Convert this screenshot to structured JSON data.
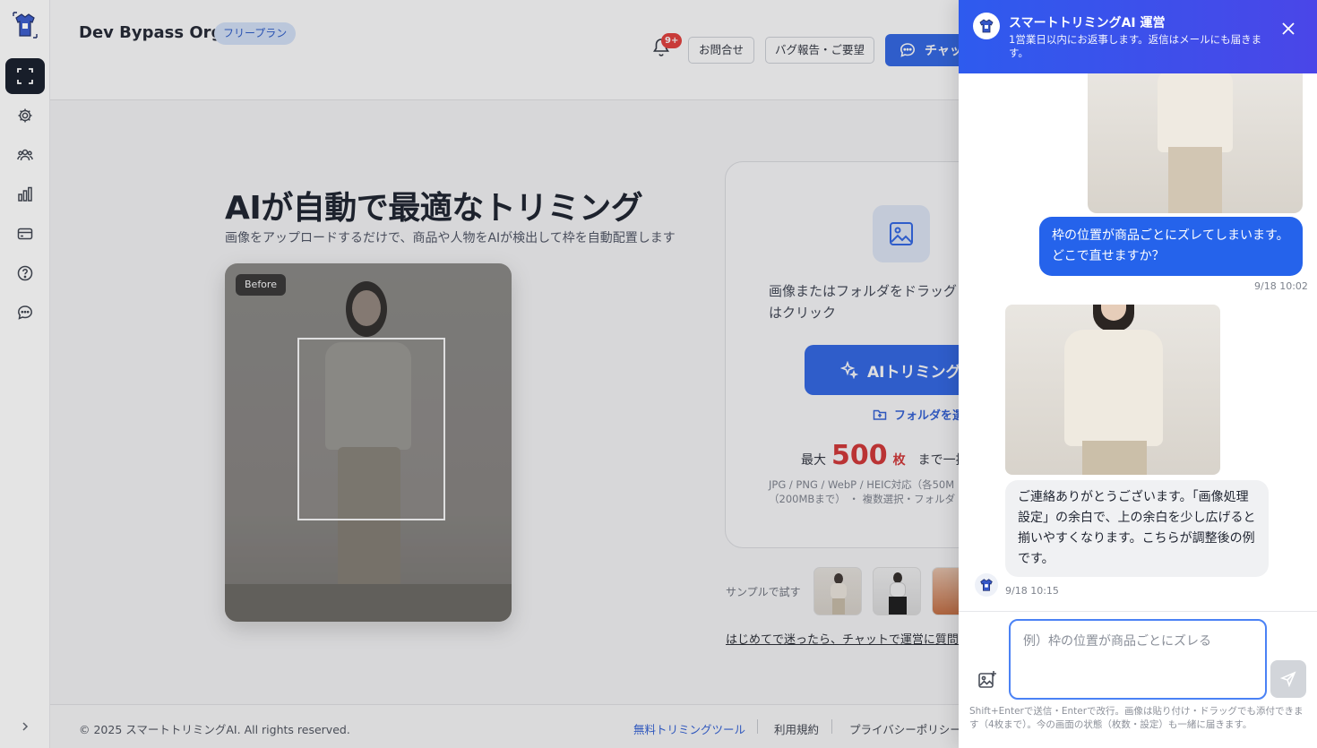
{
  "sidebar": {
    "items": [
      {
        "name": "trim",
        "icon": "expand-icon",
        "active": true
      },
      {
        "name": "settings",
        "icon": "gear-icon"
      },
      {
        "name": "team",
        "icon": "users-icon"
      },
      {
        "name": "stats",
        "icon": "bar-chart-icon"
      },
      {
        "name": "billing",
        "icon": "card-icon"
      },
      {
        "name": "help",
        "icon": "help-circle-icon"
      },
      {
        "name": "chat",
        "icon": "chat-bubble-icon"
      }
    ],
    "expander_icon": "chevron-right-icon"
  },
  "header": {
    "org_name": "Dev Bypass Org",
    "plan_badge": "フリープラン",
    "notification_count": "9+",
    "contact_label": "お問合せ",
    "bug_label": "バグ報告・ご要望",
    "chat_label": "チャッ"
  },
  "hero": {
    "title": "AIが自動で最適なトリミング",
    "subtitle": "画像をアップロードするだけで、商品や人物をAIが検出して枠を自動配置します",
    "before_tag": "Before"
  },
  "upload": {
    "drop_text": "画像またはフォルダをドラッグ\nはクリック",
    "ai_button": "AIトリミング",
    "folder_link": "フォルダを選",
    "max_prefix": "最大",
    "max_number": "500",
    "max_unit": "枚",
    "max_suffix": "まで一括",
    "formats": "JPG / PNG / WebP / HEIC対応（各50M\n（200MBまで） ・ 複数選択・フォルダ"
  },
  "samples": {
    "label": "サンプルで試す"
  },
  "help_link": "はじめてで迷ったら、チャットで運営に質問で",
  "footer": {
    "copyright": "© 2025 スマートトリミングAI. All rights reserved.",
    "links": [
      "無料トリミングツール",
      "利用規約",
      "プライバシーポリシー"
    ]
  },
  "chat": {
    "title": "スマートトリミングAI 運営",
    "subtitle": "1営業日以内にお返事します。返信はメールにも届きます。",
    "messages": [
      {
        "from": "user",
        "text": "枠の位置が商品ごとにズレてしまいます。どこで直せますか？",
        "time": "9/18 10:02"
      },
      {
        "from": "bot",
        "text": "ご連絡ありがとうございます。「画像処理設定」の余白で、上の余白を少し広げると揃いやすくなります。こちらが調整後の例です。",
        "time": "9/18 10:15"
      }
    ],
    "input_placeholder": "例）枠の位置が商品ごとにズレる",
    "hint": "Shift+Enterで送信・Enterで改行。画像は貼り付け・ドラッグでも添付できます（4枚まで）。今の画面の状態（枚数・設定）も一緒に届きます。"
  },
  "colors": {
    "accent": "#2a62e6",
    "highlight": "#d32f2f",
    "chat_header_start": "#2e5bee",
    "chat_header_end": "#4a46e8"
  }
}
